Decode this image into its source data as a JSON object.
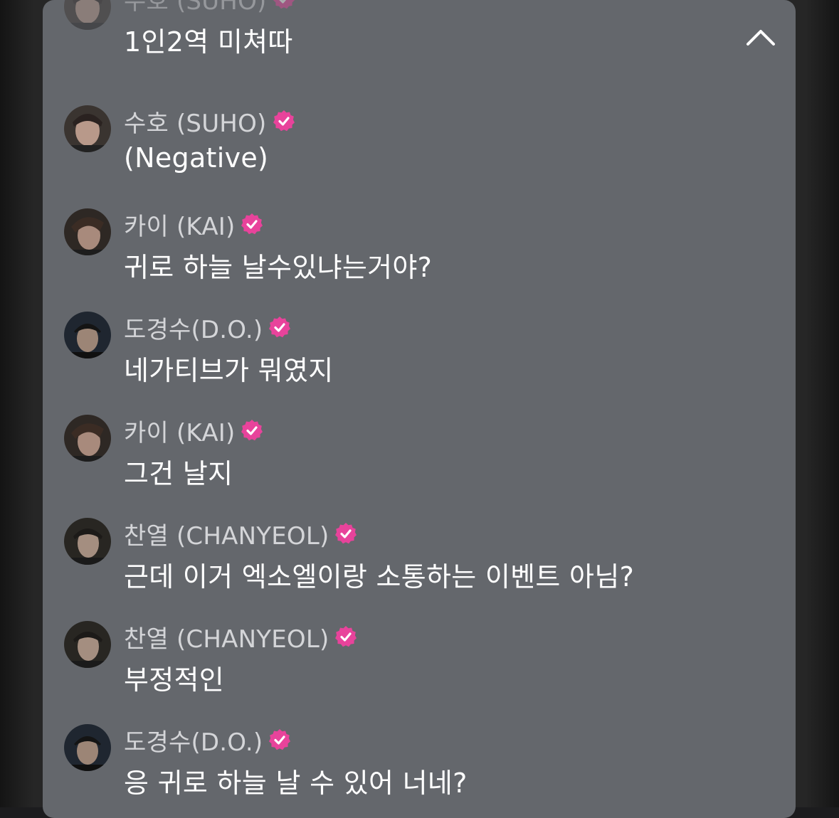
{
  "chat": {
    "collapse_icon": "chevron-up-icon",
    "verified_icon": "verified-badge-icon",
    "badge_color": "#e8439b",
    "panel_color": "#64676c",
    "messages": [
      {
        "author": "수호 (SUHO)",
        "text": "1인2역 미쳐따",
        "avatar": "suho"
      },
      {
        "author": "수호 (SUHO)",
        "text": "(Negative)",
        "avatar": "suho"
      },
      {
        "author": "카이 (KAI)",
        "text": "귀로 하늘 날수있냐는거야?",
        "avatar": "kai"
      },
      {
        "author": "도경수(D.O.)",
        "text": "네가티브가 뭐였지",
        "avatar": "do"
      },
      {
        "author": "카이 (KAI)",
        "text": "그건 날지",
        "avatar": "kai"
      },
      {
        "author": "찬열 (CHANYEOL)",
        "text": "근데 이거 엑소엘이랑 소통하는 이벤트 아님?",
        "avatar": "chanyeol"
      },
      {
        "author": "찬열 (CHANYEOL)",
        "text": "부정적인",
        "avatar": "chanyeol"
      },
      {
        "author": "도경수(D.O.)",
        "text": "응 귀로 하늘 날 수 있어 너네?",
        "avatar": "do"
      }
    ]
  }
}
